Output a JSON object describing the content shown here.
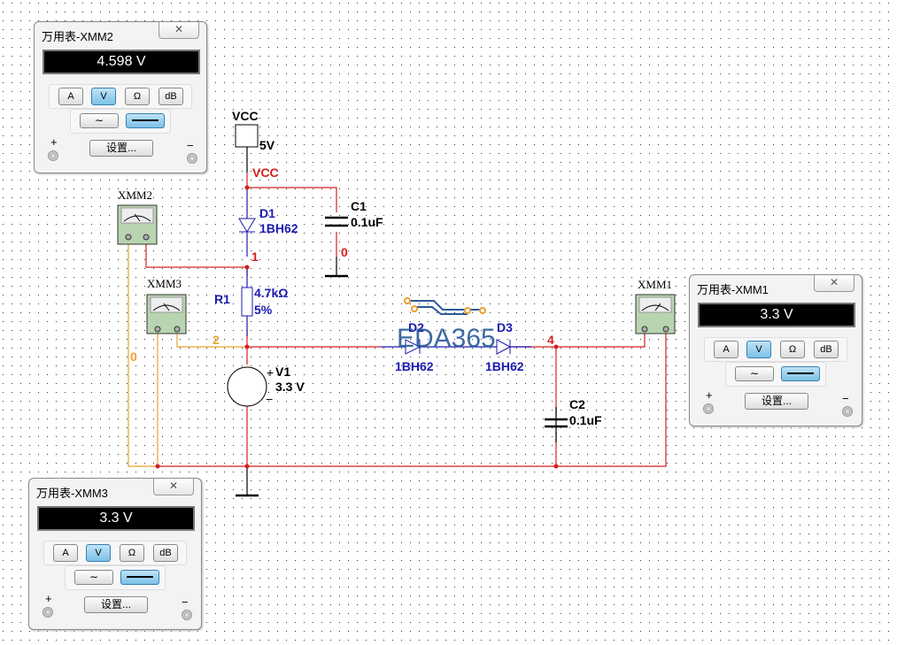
{
  "schematic": {
    "vcc_symbol_label": "VCC",
    "vcc_value": "5V",
    "net_vcc": "VCC",
    "d1": {
      "ref": "D1",
      "model": "1BH62"
    },
    "c1": {
      "ref": "C1",
      "value": "0.1uF"
    },
    "net_0_c1": "0",
    "net_1": "1",
    "r1": {
      "ref": "R1",
      "value": "4.7kΩ",
      "tol": "5%"
    },
    "net_2": "2",
    "v1": {
      "ref": "V1",
      "value": "3.3 V",
      "plus": "+",
      "minus": "−"
    },
    "net_0": "0",
    "d2": {
      "ref": "D2",
      "model": "1BH62"
    },
    "d3": {
      "ref": "D3",
      "model": "1BH62"
    },
    "net_4": "4",
    "c2": {
      "ref": "C2",
      "value": "0.1uF"
    },
    "xmm1_label": "XMM1",
    "xmm2_label": "XMM2",
    "xmm3_label": "XMM3",
    "watermark": "EDA365",
    "colors": {
      "wire_red": "#d42020",
      "wire_orange": "#e8a030",
      "component_blue": "#1a1ab0",
      "meter_green": "#b9d4b0"
    }
  },
  "meters": [
    {
      "title": "万用表-XMM2",
      "reading": "4.598 V",
      "modes": [
        "A",
        "V",
        "Ω",
        "dB"
      ],
      "active_mode": "V",
      "active_wave": "dc",
      "settings": "设置...",
      "plus": "+",
      "minus": "−",
      "close": "✕"
    },
    {
      "title": "万用表-XMM1",
      "reading": "3.3 V",
      "modes": [
        "A",
        "V",
        "Ω",
        "dB"
      ],
      "active_mode": "V",
      "active_wave": "dc",
      "settings": "设置...",
      "plus": "+",
      "minus": "−",
      "close": "✕"
    },
    {
      "title": "万用表-XMM3",
      "reading": "3.3 V",
      "modes": [
        "A",
        "V",
        "Ω",
        "dB"
      ],
      "active_mode": "V",
      "active_wave": "dc",
      "settings": "设置...",
      "plus": "+",
      "minus": "−",
      "close": "✕"
    }
  ]
}
